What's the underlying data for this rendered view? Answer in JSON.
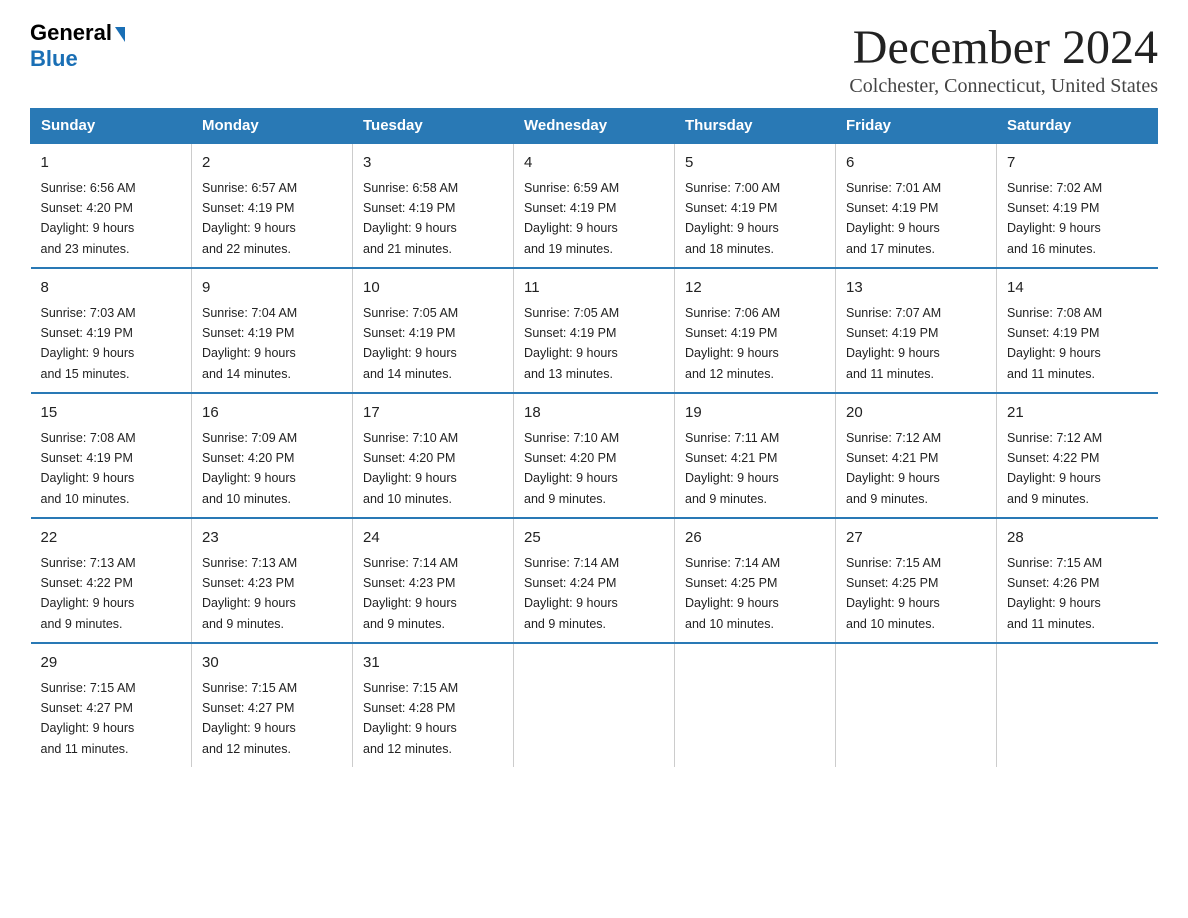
{
  "logo": {
    "general": "General",
    "blue": "Blue"
  },
  "title": "December 2024",
  "location": "Colchester, Connecticut, United States",
  "weekdays": [
    "Sunday",
    "Monday",
    "Tuesday",
    "Wednesday",
    "Thursday",
    "Friday",
    "Saturday"
  ],
  "weeks": [
    [
      {
        "day": "1",
        "sunrise": "6:56 AM",
        "sunset": "4:20 PM",
        "daylight": "9 hours and 23 minutes."
      },
      {
        "day": "2",
        "sunrise": "6:57 AM",
        "sunset": "4:19 PM",
        "daylight": "9 hours and 22 minutes."
      },
      {
        "day": "3",
        "sunrise": "6:58 AM",
        "sunset": "4:19 PM",
        "daylight": "9 hours and 21 minutes."
      },
      {
        "day": "4",
        "sunrise": "6:59 AM",
        "sunset": "4:19 PM",
        "daylight": "9 hours and 19 minutes."
      },
      {
        "day": "5",
        "sunrise": "7:00 AM",
        "sunset": "4:19 PM",
        "daylight": "9 hours and 18 minutes."
      },
      {
        "day": "6",
        "sunrise": "7:01 AM",
        "sunset": "4:19 PM",
        "daylight": "9 hours and 17 minutes."
      },
      {
        "day": "7",
        "sunrise": "7:02 AM",
        "sunset": "4:19 PM",
        "daylight": "9 hours and 16 minutes."
      }
    ],
    [
      {
        "day": "8",
        "sunrise": "7:03 AM",
        "sunset": "4:19 PM",
        "daylight": "9 hours and 15 minutes."
      },
      {
        "day": "9",
        "sunrise": "7:04 AM",
        "sunset": "4:19 PM",
        "daylight": "9 hours and 14 minutes."
      },
      {
        "day": "10",
        "sunrise": "7:05 AM",
        "sunset": "4:19 PM",
        "daylight": "9 hours and 14 minutes."
      },
      {
        "day": "11",
        "sunrise": "7:05 AM",
        "sunset": "4:19 PM",
        "daylight": "9 hours and 13 minutes."
      },
      {
        "day": "12",
        "sunrise": "7:06 AM",
        "sunset": "4:19 PM",
        "daylight": "9 hours and 12 minutes."
      },
      {
        "day": "13",
        "sunrise": "7:07 AM",
        "sunset": "4:19 PM",
        "daylight": "9 hours and 11 minutes."
      },
      {
        "day": "14",
        "sunrise": "7:08 AM",
        "sunset": "4:19 PM",
        "daylight": "9 hours and 11 minutes."
      }
    ],
    [
      {
        "day": "15",
        "sunrise": "7:08 AM",
        "sunset": "4:19 PM",
        "daylight": "9 hours and 10 minutes."
      },
      {
        "day": "16",
        "sunrise": "7:09 AM",
        "sunset": "4:20 PM",
        "daylight": "9 hours and 10 minutes."
      },
      {
        "day": "17",
        "sunrise": "7:10 AM",
        "sunset": "4:20 PM",
        "daylight": "9 hours and 10 minutes."
      },
      {
        "day": "18",
        "sunrise": "7:10 AM",
        "sunset": "4:20 PM",
        "daylight": "9 hours and 9 minutes."
      },
      {
        "day": "19",
        "sunrise": "7:11 AM",
        "sunset": "4:21 PM",
        "daylight": "9 hours and 9 minutes."
      },
      {
        "day": "20",
        "sunrise": "7:12 AM",
        "sunset": "4:21 PM",
        "daylight": "9 hours and 9 minutes."
      },
      {
        "day": "21",
        "sunrise": "7:12 AM",
        "sunset": "4:22 PM",
        "daylight": "9 hours and 9 minutes."
      }
    ],
    [
      {
        "day": "22",
        "sunrise": "7:13 AM",
        "sunset": "4:22 PM",
        "daylight": "9 hours and 9 minutes."
      },
      {
        "day": "23",
        "sunrise": "7:13 AM",
        "sunset": "4:23 PM",
        "daylight": "9 hours and 9 minutes."
      },
      {
        "day": "24",
        "sunrise": "7:14 AM",
        "sunset": "4:23 PM",
        "daylight": "9 hours and 9 minutes."
      },
      {
        "day": "25",
        "sunrise": "7:14 AM",
        "sunset": "4:24 PM",
        "daylight": "9 hours and 9 minutes."
      },
      {
        "day": "26",
        "sunrise": "7:14 AM",
        "sunset": "4:25 PM",
        "daylight": "9 hours and 10 minutes."
      },
      {
        "day": "27",
        "sunrise": "7:15 AM",
        "sunset": "4:25 PM",
        "daylight": "9 hours and 10 minutes."
      },
      {
        "day": "28",
        "sunrise": "7:15 AM",
        "sunset": "4:26 PM",
        "daylight": "9 hours and 11 minutes."
      }
    ],
    [
      {
        "day": "29",
        "sunrise": "7:15 AM",
        "sunset": "4:27 PM",
        "daylight": "9 hours and 11 minutes."
      },
      {
        "day": "30",
        "sunrise": "7:15 AM",
        "sunset": "4:27 PM",
        "daylight": "9 hours and 12 minutes."
      },
      {
        "day": "31",
        "sunrise": "7:15 AM",
        "sunset": "4:28 PM",
        "daylight": "9 hours and 12 minutes."
      },
      null,
      null,
      null,
      null
    ]
  ],
  "colors": {
    "header_bg": "#2979b5",
    "header_text": "#ffffff",
    "border": "#2979b5"
  }
}
